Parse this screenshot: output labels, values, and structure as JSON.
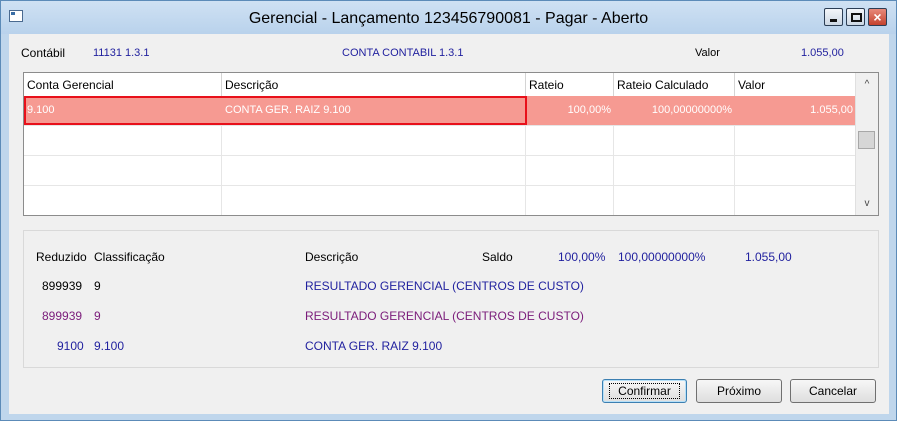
{
  "window": {
    "title": "Gerencial -  Lançamento 123456790081 - Pagar - Aberto",
    "close_glyph": "×"
  },
  "header": {
    "contabil_label": "Contábil",
    "contabil_value": "11131  1.3.1",
    "conta_label": "CONTA CONTABIL 1.3.1",
    "valor_label": "Valor",
    "valor_value": "1.055,00"
  },
  "grid": {
    "columns": [
      "Conta Gerencial",
      "Descrição",
      "Rateio",
      "Rateio Calculado",
      "Valor"
    ],
    "rows": [
      {
        "conta": "9.100",
        "descricao": "CONTA GER. RAIZ 9.100",
        "rateio": "100,00%",
        "rateio_calc": "100,00000000%",
        "valor": "1.055,00"
      }
    ],
    "scroll_up": "^",
    "scroll_down": "v"
  },
  "panel": {
    "headers": {
      "reduzido": "Reduzido",
      "classificacao": "Classificação",
      "descricao": "Descrição",
      "saldo": "Saldo"
    },
    "totals": {
      "rateio": "100,00%",
      "rateio_calc": "100,00000000%",
      "valor": "1.055,00"
    },
    "rows": [
      {
        "reduzido": "899939",
        "classificacao": "9",
        "descricao": "RESULTADO GERENCIAL (CENTROS DE CUSTO)"
      },
      {
        "reduzido": "899939",
        "classificacao": "9",
        "descricao": "RESULTADO GERENCIAL (CENTROS DE CUSTO)"
      },
      {
        "reduzido": "9100",
        "classificacao": "9.100",
        "descricao": "CONTA GER. RAIZ 9.100"
      }
    ]
  },
  "buttons": {
    "confirmar": "Confirmar",
    "proximo": "Próximo",
    "cancelar": "Cancelar"
  },
  "colors": {
    "selected_row": "#f69a92",
    "highlight_border": "#e8101a",
    "value_blue": "#1f1f9e",
    "value_purple": "#7a1b7a"
  }
}
